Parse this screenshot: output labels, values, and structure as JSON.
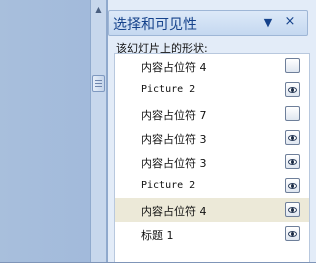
{
  "pane": {
    "title": "选择和可见性",
    "section_label": "该幻灯片上的形状:",
    "dropdown_icon": "triangle-down-icon",
    "close_label": "×"
  },
  "shapes": [
    {
      "label": "内容占位符 4",
      "visible": false,
      "mono": false,
      "highlighted": false
    },
    {
      "label": "Picture 2",
      "visible": true,
      "mono": true,
      "highlighted": false
    },
    {
      "label": "内容占位符 7",
      "visible": false,
      "mono": false,
      "highlighted": false
    },
    {
      "label": "内容占位符 3",
      "visible": true,
      "mono": false,
      "highlighted": false
    },
    {
      "label": "内容占位符 3",
      "visible": true,
      "mono": false,
      "highlighted": false
    },
    {
      "label": "Picture 2",
      "visible": true,
      "mono": true,
      "highlighted": false
    },
    {
      "label": "内容占位符 4",
      "visible": true,
      "mono": false,
      "highlighted": true
    },
    {
      "label": "标题 1",
      "visible": true,
      "mono": false,
      "highlighted": false
    }
  ],
  "colors": {
    "pane_bg": "#e3ecf8",
    "title_text": "#15428b",
    "highlight_row": "#ece9d8",
    "slide_area": "#a8bfdc"
  }
}
